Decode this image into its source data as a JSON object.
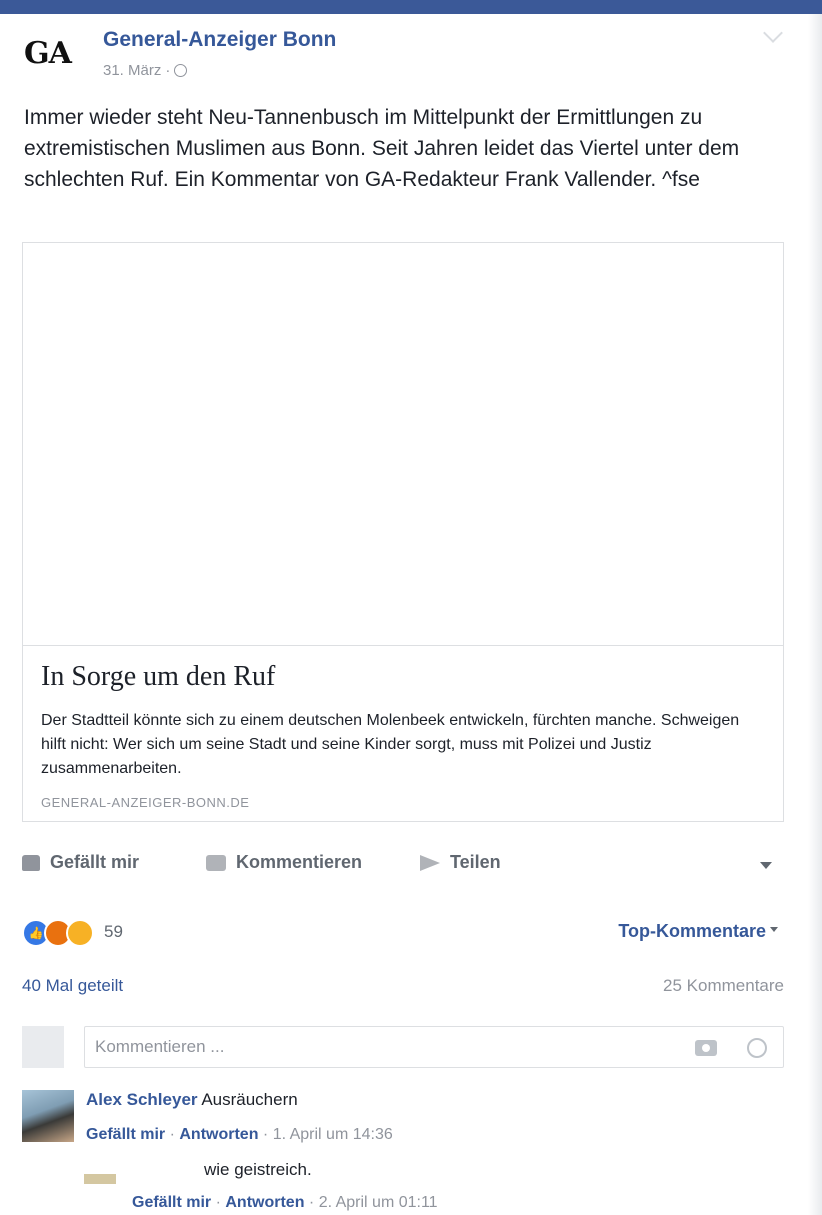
{
  "post": {
    "logo_text": "GA",
    "page_name": "General-Anzeiger Bonn",
    "date": "31. März",
    "separator": "·",
    "text": "Immer wieder steht Neu-Tannenbusch im Mittelpunkt der Ermittlungen zu extremistischen Muslimen aus Bonn. Seit Jahren leidet das Viertel unter dem schlechten Ruf. Ein Kommentar von GA-Redakteur Frank Vallender. ^fse"
  },
  "link_card": {
    "title": "In Sorge um den Ruf",
    "description": "Der Stadtteil könnte sich zu einem deutschen Molenbeek entwickeln, fürchten manche. Schweigen hilft nicht: Wer sich um seine Stadt und seine Kinder sorgt, muss mit Polizei und Justiz zusammenarbeiten.",
    "domain": "GENERAL-ANZEIGER-BONN.DE"
  },
  "actions": {
    "like": "Gefällt mir",
    "comment": "Kommentieren",
    "share": "Teilen"
  },
  "reactions": {
    "count": "59",
    "sort_label": "Top-Kommentare",
    "colors": {
      "like": "#3578e5",
      "angry": "#e9710f",
      "sad": "#f7b125"
    }
  },
  "stats": {
    "shares": "40 Mal geteilt",
    "comments": "25 Kommentare"
  },
  "composer": {
    "placeholder": "Kommentieren ..."
  },
  "comments": [
    {
      "author": "Alex Schleyer",
      "text": "Ausräuchern",
      "like": "Gefällt mir",
      "reply": "Antworten",
      "time": "1. April um 14:36"
    },
    {
      "author": "",
      "text": "wie geistreich.",
      "like": "Gefällt mir",
      "reply": "Antworten",
      "time": "2. April um 01:11"
    }
  ],
  "colors": {
    "brand": "#3b5998",
    "link": "#365899",
    "muted": "#90949c"
  }
}
